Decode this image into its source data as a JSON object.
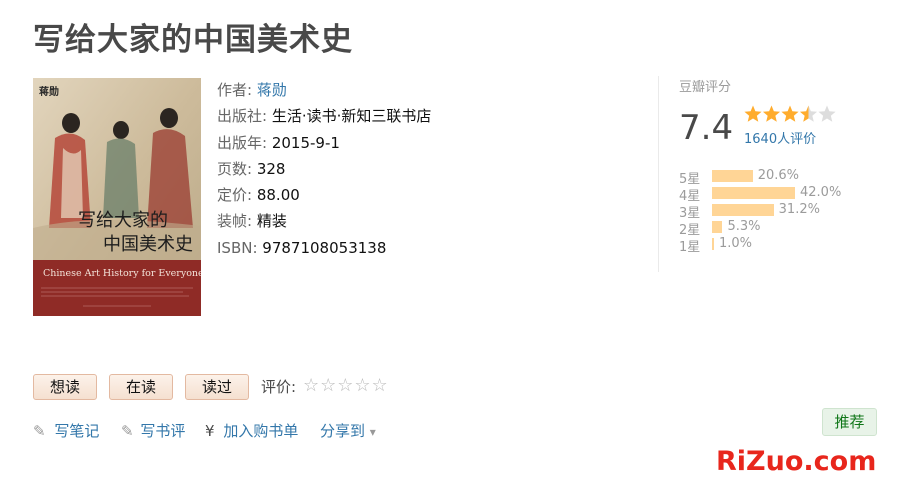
{
  "title": "写给大家的中国美术史",
  "cover": {
    "author_mark": "蒋勋",
    "title_line1": "写给大家的",
    "title_line2": "中国美术史",
    "english_title": "Chinese Art History for Everyone"
  },
  "info": {
    "author_label": "作者:",
    "author_value": "蒋勋",
    "publisher_label": "出版社:",
    "publisher_value": "生活·读书·新知三联书店",
    "pubyear_label": "出版年:",
    "pubyear_value": "2015-9-1",
    "pages_label": "页数:",
    "pages_value": "328",
    "price_label": "定价:",
    "price_value": "88.00",
    "binding_label": "装帧:",
    "binding_value": "精装",
    "isbn_label": "ISBN:",
    "isbn_value": "9787108053138"
  },
  "rating": {
    "label": "豆瓣评分",
    "score": "7.4",
    "stars": 3.5,
    "votes": "1640人评价",
    "distribution": [
      {
        "label": "5星",
        "pct_text": "20.6%",
        "pct": 20.6
      },
      {
        "label": "4星",
        "pct_text": "42.0%",
        "pct": 42.0
      },
      {
        "label": "3星",
        "pct_text": "31.2%",
        "pct": 31.2
      },
      {
        "label": "2星",
        "pct_text": "5.3%",
        "pct": 5.3
      },
      {
        "label": "1星",
        "pct_text": "1.0%",
        "pct": 1.0
      }
    ]
  },
  "buttons": {
    "want": "想读",
    "reading": "在读",
    "read": "读过"
  },
  "rate": {
    "label": "评价:",
    "stars": "☆☆☆☆☆"
  },
  "actions": {
    "note": "写笔记",
    "review": "写书评",
    "cart_symbol": "¥",
    "cart": "加入购书单",
    "share": "分享到",
    "share_arrow": "▾"
  },
  "recommend": "推荐",
  "watermark": "RiZuo.com",
  "colors": {
    "link": "#3377aa",
    "star": "#ffac2d",
    "bar": "#ffd596",
    "button_border": "#e3b9a1",
    "recommend_text": "#0f7618",
    "watermark": "#e8261c"
  }
}
